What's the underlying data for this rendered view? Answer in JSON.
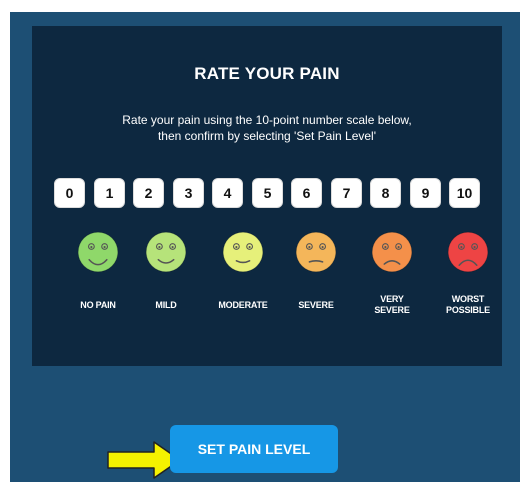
{
  "title": "RATE YOUR PAIN",
  "subtitle_line1": "Rate your pain using the 10-point number scale below,",
  "subtitle_line2": "then confirm by selecting 'Set Pain Level'",
  "scale_numbers": [
    "0",
    "1",
    "2",
    "3",
    "4",
    "5",
    "6",
    "7",
    "8",
    "9",
    "10"
  ],
  "faces": [
    {
      "label_line1": "NO PAIN",
      "label_line2": "",
      "color": "#8fd86a",
      "expression": "big-smile"
    },
    {
      "label_line1": "MILD",
      "label_line2": "",
      "color": "#b6e37a",
      "expression": "smile"
    },
    {
      "label_line1": "MODERATE",
      "label_line2": "",
      "color": "#e6f07a",
      "expression": "neutral-smile"
    },
    {
      "label_line1": "SEVERE",
      "label_line2": "",
      "color": "#f4b65a",
      "expression": "neutral"
    },
    {
      "label_line1": "VERY",
      "label_line2": "SEVERE",
      "color": "#f4904a",
      "expression": "frown"
    },
    {
      "label_line1": "WORST",
      "label_line2": "POSSIBLE",
      "color": "#ee4444",
      "expression": "big-frown"
    }
  ],
  "set_button_label": "SET PAIN LEVEL",
  "colors": {
    "frame": "#1d4f74",
    "panel": "#0d2840",
    "button": "#1697e6",
    "arrow": "#f5f200"
  },
  "icons": {
    "arrow": "right-arrow-icon",
    "face": "pain-face-icon"
  }
}
